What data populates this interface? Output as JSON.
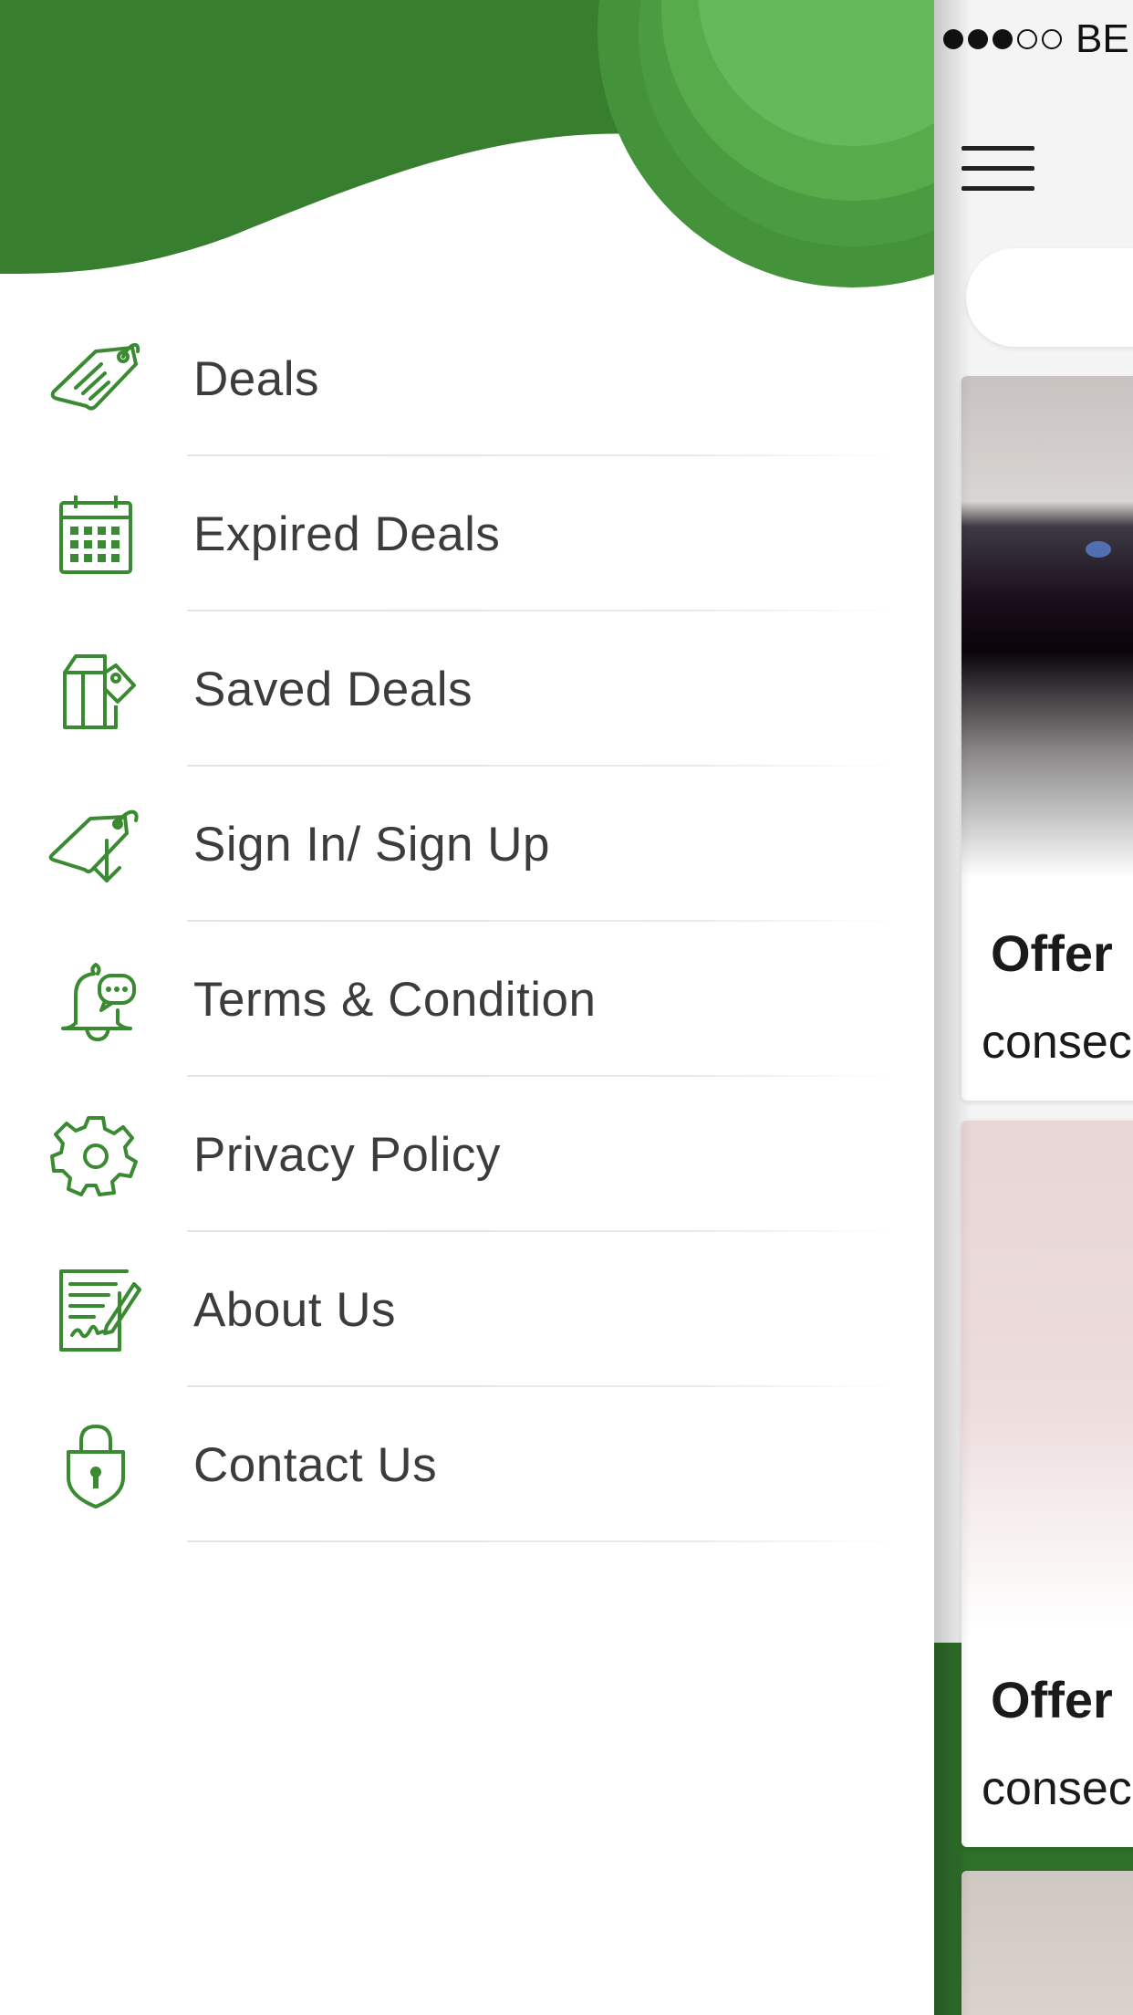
{
  "drawer": {
    "brand_colors": {
      "primary": "#377e2f",
      "light": "#64b95a",
      "mid": "#4a9a3f"
    },
    "menu_items": [
      {
        "label": "Deals",
        "icon": "price-tag-icon"
      },
      {
        "label": "Expired Deals",
        "icon": "calendar-icon"
      },
      {
        "label": "Saved Deals",
        "icon": "shopping-bag-tag-icon"
      },
      {
        "label": "Sign In/ Sign Up",
        "icon": "tag-download-icon"
      },
      {
        "label": "Terms & Condition",
        "icon": "bell-chat-icon"
      },
      {
        "label": "Privacy Policy",
        "icon": "gear-icon"
      },
      {
        "label": "About Us",
        "icon": "document-signature-icon"
      },
      {
        "label": "Contact Us",
        "icon": "shield-lock-icon"
      }
    ]
  },
  "main_screen": {
    "status_bar": {
      "carrier": "BE",
      "signal_bars_on": 3,
      "signal_bars_total": 5
    },
    "menu_icon": "hamburger-icon",
    "deals": [
      {
        "title": "Offer",
        "description": "consec"
      },
      {
        "title": "Offer",
        "description": "consec"
      }
    ]
  }
}
